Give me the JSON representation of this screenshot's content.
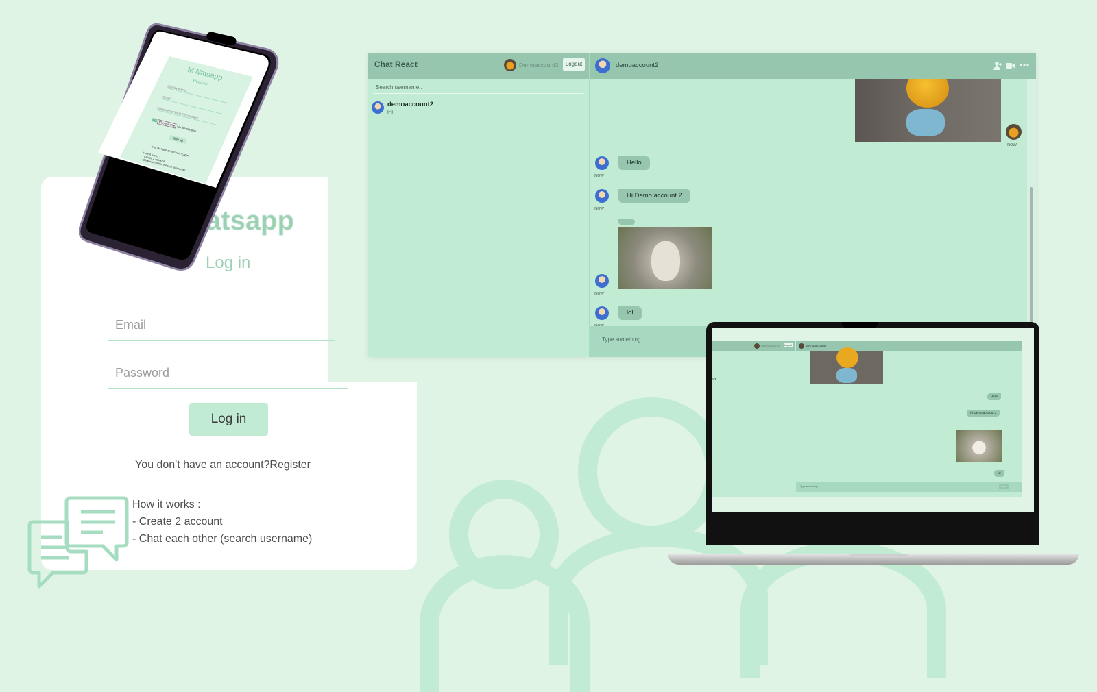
{
  "login": {
    "app_title": "atsapp",
    "subtitle": "Log in",
    "email_placeholder": "Email",
    "password_placeholder": "Password",
    "login_button": "Log in",
    "register_text": "You don't have an account?Register",
    "how_title": "How it works :",
    "how_steps": [
      "- Create 2 account",
      "- Chat each other (search username)"
    ]
  },
  "phone": {
    "app_title": "MWatsapp",
    "subtitle": "Register",
    "fields": [
      "Display Name",
      "Email",
      "Password at least 6 characters"
    ],
    "file_button": "Choose File",
    "file_text": "No file chosen",
    "signup_button": "Sign up",
    "login_link": "You do have an account?Login",
    "how_title": "How it works :",
    "how_steps": [
      "- Create 2 account",
      "- Chat each other (search username)"
    ]
  },
  "app": {
    "title": "Chat React",
    "current_user": "Demoaccount3",
    "logout": "Logout",
    "search_placeholder": "Search username..",
    "contacts": [
      {
        "name": "demoaccount2",
        "last_message": "lol"
      }
    ],
    "chat_with": "demoaccount2",
    "messages": [
      {
        "type": "image",
        "owner": true,
        "time": "now"
      },
      {
        "type": "text",
        "text": "Hello",
        "time": "now"
      },
      {
        "type": "text",
        "text": "Hi Demo account 2",
        "time": "now"
      },
      {
        "type": "image",
        "text": "",
        "time": "now"
      },
      {
        "type": "text",
        "text": "lol",
        "time": "now"
      }
    ],
    "input_placeholder": "Type something..",
    "send": "Send"
  },
  "laptop": {
    "current_user": "Demoaccount3",
    "logout": "Logout",
    "contact_fragment": "nt2",
    "chat_with": "demoaccount2",
    "messages": [
      "Hello",
      "Hi Demo account 2",
      "lol"
    ],
    "input_placeholder": "Type something...",
    "send": "Send"
  },
  "icons": [
    "chat-bubbles-icon",
    "add-user-icon",
    "video-camera-icon",
    "more-icon",
    "image-icon"
  ],
  "colors": {
    "accent": "#96c6ae",
    "panel": "#c2ebd3",
    "background": "#e0f4e6"
  }
}
